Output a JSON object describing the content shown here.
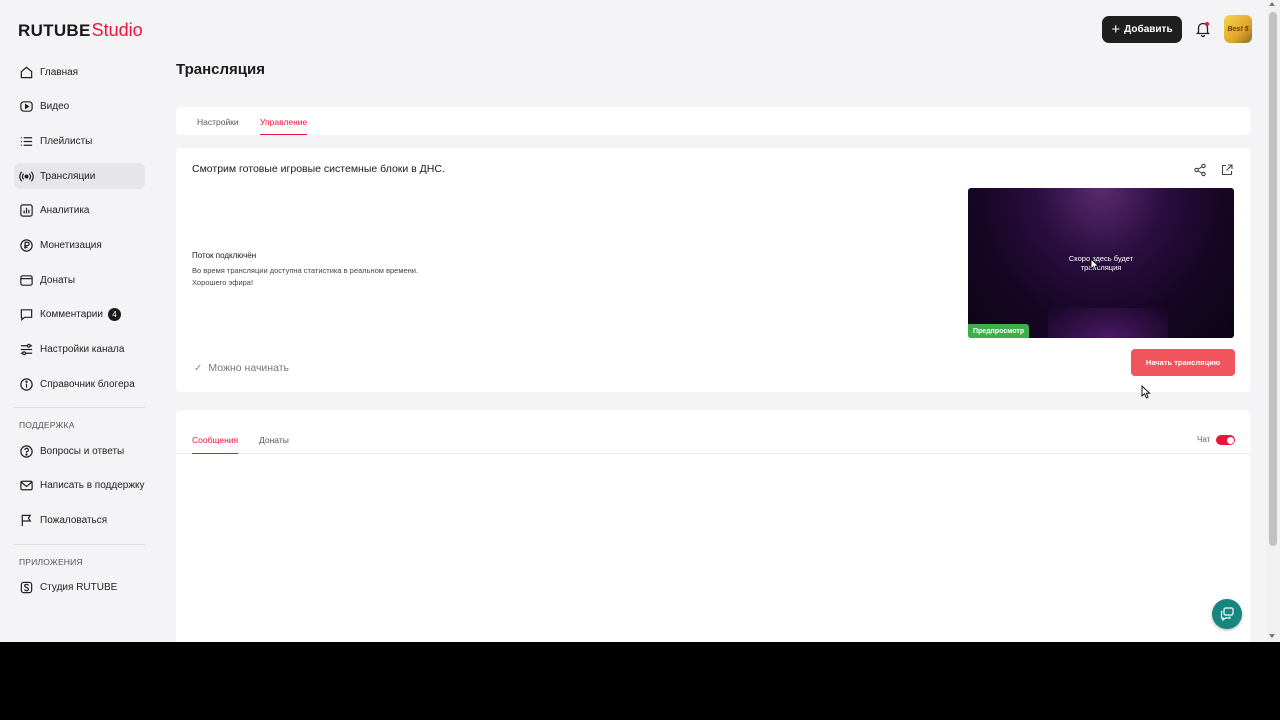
{
  "app": {
    "logo_main": "RUTUBE",
    "logo_sub": "Studio"
  },
  "colors": {
    "accent": "#ed143b",
    "preview_label": "#3fae49",
    "start_button": "#f0545d",
    "help_fab": "#16877f"
  },
  "sidebar": {
    "items": [
      {
        "label": "Главная",
        "icon": "home-icon"
      },
      {
        "label": "Видео",
        "icon": "video-icon"
      },
      {
        "label": "Плейлисты",
        "icon": "playlist-icon"
      },
      {
        "label": "Трансляции",
        "icon": "broadcast-icon",
        "active": true
      },
      {
        "label": "Аналитика",
        "icon": "analytics-icon"
      },
      {
        "label": "Монетизация",
        "icon": "ruble-icon"
      },
      {
        "label": "Донаты",
        "icon": "donate-icon"
      },
      {
        "label": "Комментарии",
        "icon": "comment-icon",
        "badge": "4"
      },
      {
        "label": "Настройки канала",
        "icon": "settings-icon"
      },
      {
        "label": "Справочник блогера",
        "icon": "info-icon"
      }
    ],
    "support_title": "ПОДДЕРЖКА",
    "support_items": [
      {
        "label": "Вопросы и ответы",
        "icon": "question-icon"
      },
      {
        "label": "Написать в поддержку",
        "icon": "mail-icon"
      },
      {
        "label": "Пожаловаться",
        "icon": "flag-icon"
      }
    ],
    "apps_title": "ПРИЛОЖЕНИЯ",
    "apps_items": [
      {
        "label": "Студия RUTUBE",
        "icon": "studio-app-icon"
      }
    ]
  },
  "header": {
    "add_label": "Добавить",
    "avatar_text": "Best 5"
  },
  "page": {
    "title": "Трансляция",
    "tabs": [
      "Настройки",
      "Управление"
    ]
  },
  "stream": {
    "title": "Смотрим готовые игровые системные блоки в ДНС.",
    "status_title": "Поток подключён",
    "status_line1": "Во время трансляции доступна статистика в реальном времени.",
    "status_line2": "Хорошего эфира!",
    "ready_label": "Можно начинать",
    "preview_text_line1": "Скоро здесь будет",
    "preview_text_line2": "трансляция",
    "preview_label": "Предпросмотр",
    "start_label": "Начать трансляцию"
  },
  "chat": {
    "tabs": [
      "Сообщения",
      "Донаты"
    ],
    "toggle_label": "Чат",
    "toggle_on": true
  }
}
